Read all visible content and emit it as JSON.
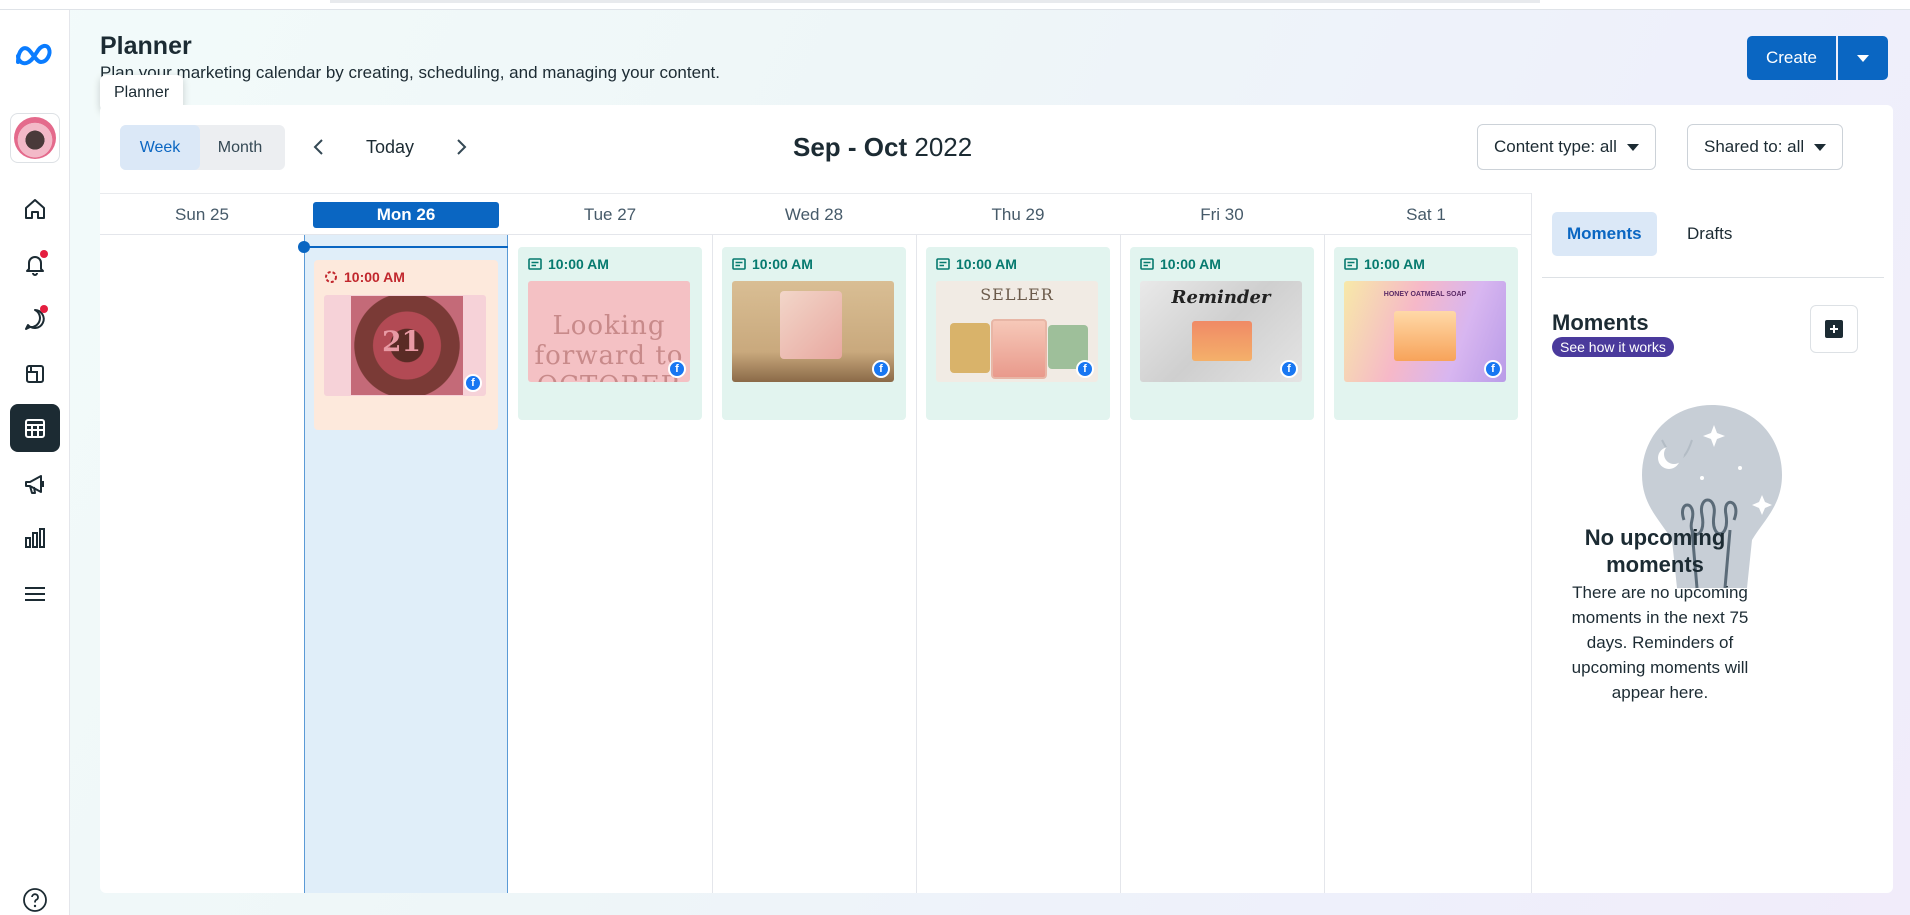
{
  "header": {
    "title": "Planner",
    "subtitle": "Plan your marketing calendar by creating, scheduling, and managing your content.",
    "tooltip": "Planner",
    "create_label": "Create"
  },
  "nav": {
    "items": [
      "home-icon",
      "bell-icon",
      "chat-icon",
      "posts-icon",
      "planner-icon",
      "megaphone-icon",
      "insights-icon",
      "menu-icon"
    ],
    "active": "planner-icon",
    "help": "help-icon"
  },
  "toolbar": {
    "week_label": "Week",
    "month_label": "Month",
    "today_label": "Today",
    "range_bold": "Sep - Oct",
    "range_year": "2022",
    "content_type": "Content type: all",
    "shared_to": "Shared to: all"
  },
  "days": [
    {
      "label": "Sun 25"
    },
    {
      "label": "Mon 26",
      "today": true
    },
    {
      "label": "Tue 27"
    },
    {
      "label": "Wed 28"
    },
    {
      "label": "Thu 29"
    },
    {
      "label": "Fri 30"
    },
    {
      "label": "Sat 1"
    }
  ],
  "posts": [
    {
      "time": "10:00 AM",
      "status": "draft",
      "platform": "facebook",
      "image_text": "21"
    },
    {
      "time": "10:00 AM",
      "status": "scheduled",
      "platform": "facebook",
      "image_text": "Looking forward to OCTOBER"
    },
    {
      "time": "10:00 AM",
      "status": "scheduled",
      "platform": "facebook",
      "image_text": ""
    },
    {
      "time": "10:00 AM",
      "status": "scheduled",
      "platform": "facebook",
      "image_text": "SELLER"
    },
    {
      "time": "10:00 AM",
      "status": "scheduled",
      "platform": "facebook",
      "image_text": "Reminder"
    },
    {
      "time": "10:00 AM",
      "status": "scheduled",
      "platform": "facebook",
      "image_text": "HONEY OATMEAL SOAP"
    }
  ],
  "right_panel": {
    "tabs": [
      "Moments",
      "Drafts"
    ],
    "selected_tab": "Moments",
    "title": "Moments",
    "badge": "See how it works",
    "empty_title": "No upcoming moments",
    "empty_text": "There are no upcoming moments in the next 75 days. Reminders of upcoming moments will appear here."
  },
  "colors": {
    "primary": "#0a66c2",
    "scheduled_bg": "#e2f4ef",
    "draft_bg": "#fde9dc",
    "today_bg": "#e0eef9"
  }
}
